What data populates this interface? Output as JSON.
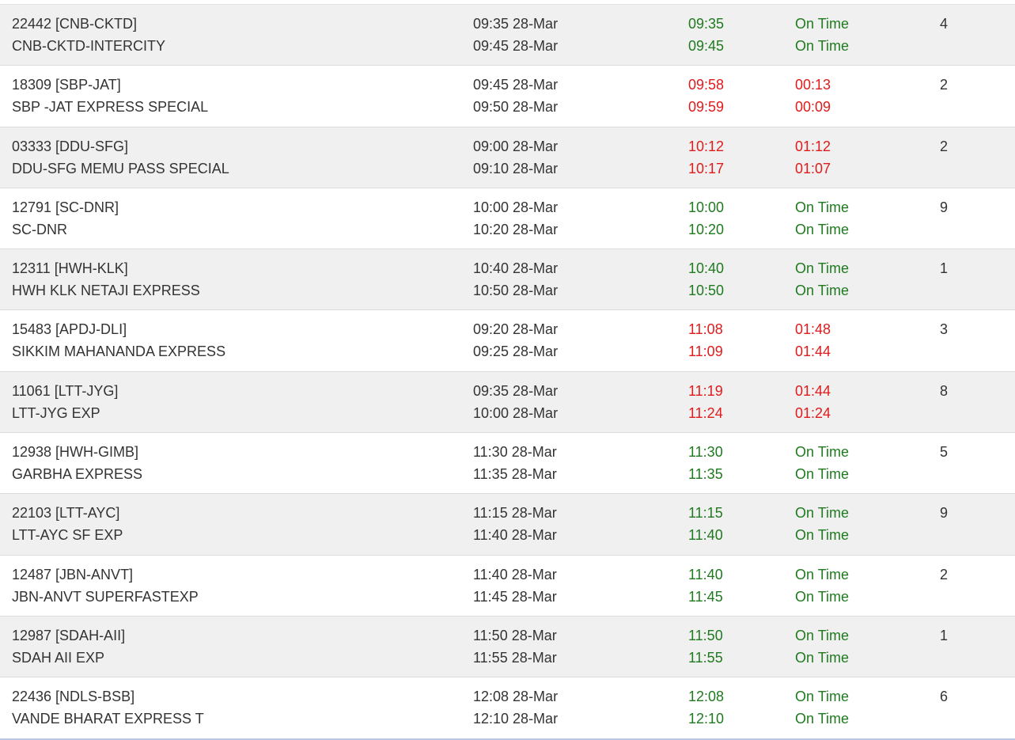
{
  "colors": {
    "on_time": "#1f7a1f",
    "delayed": "#e01b1b",
    "text": "#333333",
    "alt_row": "#f0f0f0"
  },
  "trains": [
    {
      "number": "22442 [CNB-CKTD]",
      "name": "CNB-CKTD-INTERCITY",
      "sch_arr": "09:35 28-Mar",
      "sch_dep": "09:45 28-Mar",
      "exp_arr": "09:35",
      "exp_dep": "09:45",
      "delay_arr": "On Time",
      "delay_dep": "On Time",
      "platform": "4",
      "late": false
    },
    {
      "number": "18309 [SBP-JAT]",
      "name": "SBP -JAT EXPRESS SPECIAL",
      "sch_arr": "09:45 28-Mar",
      "sch_dep": "09:50 28-Mar",
      "exp_arr": "09:58",
      "exp_dep": "09:59",
      "delay_arr": "00:13",
      "delay_dep": "00:09",
      "platform": "2",
      "late": true
    },
    {
      "number": "03333 [DDU-SFG]",
      "name": "DDU-SFG MEMU PASS SPECIAL",
      "sch_arr": "09:00 28-Mar",
      "sch_dep": "09:10 28-Mar",
      "exp_arr": "10:12",
      "exp_dep": "10:17",
      "delay_arr": "01:12",
      "delay_dep": "01:07",
      "platform": "2",
      "late": true
    },
    {
      "number": "12791 [SC-DNR]",
      "name": "SC-DNR",
      "sch_arr": "10:00 28-Mar",
      "sch_dep": "10:20 28-Mar",
      "exp_arr": "10:00",
      "exp_dep": "10:20",
      "delay_arr": "On Time",
      "delay_dep": "On Time",
      "platform": "9",
      "late": false
    },
    {
      "number": "12311 [HWH-KLK]",
      "name": "HWH KLK NETAJI EXPRESS",
      "sch_arr": "10:40 28-Mar",
      "sch_dep": "10:50 28-Mar",
      "exp_arr": "10:40",
      "exp_dep": "10:50",
      "delay_arr": "On Time",
      "delay_dep": "On Time",
      "platform": "1",
      "late": false
    },
    {
      "number": "15483 [APDJ-DLI]",
      "name": "SIKKIM MAHANANDA EXPRESS",
      "sch_arr": "09:20 28-Mar",
      "sch_dep": "09:25 28-Mar",
      "exp_arr": "11:08",
      "exp_dep": "11:09",
      "delay_arr": "01:48",
      "delay_dep": "01:44",
      "platform": "3",
      "late": true
    },
    {
      "number": "11061 [LTT-JYG]",
      "name": "LTT-JYG EXP",
      "sch_arr": "09:35 28-Mar",
      "sch_dep": "10:00 28-Mar",
      "exp_arr": "11:19",
      "exp_dep": "11:24",
      "delay_arr": "01:44",
      "delay_dep": "01:24",
      "platform": "8",
      "late": true
    },
    {
      "number": "12938 [HWH-GIMB]",
      "name": "GARBHA EXPRESS",
      "sch_arr": "11:30 28-Mar",
      "sch_dep": "11:35 28-Mar",
      "exp_arr": "11:30",
      "exp_dep": "11:35",
      "delay_arr": "On Time",
      "delay_dep": "On Time",
      "platform": "5",
      "late": false
    },
    {
      "number": "22103 [LTT-AYC]",
      "name": "LTT-AYC SF EXP",
      "sch_arr": "11:15 28-Mar",
      "sch_dep": "11:40 28-Mar",
      "exp_arr": "11:15",
      "exp_dep": "11:40",
      "delay_arr": "On Time",
      "delay_dep": "On Time",
      "platform": "9",
      "late": false
    },
    {
      "number": "12487 [JBN-ANVT]",
      "name": "JBN-ANVT SUPERFASTEXP",
      "sch_arr": "11:40 28-Mar",
      "sch_dep": "11:45 28-Mar",
      "exp_arr": "11:40",
      "exp_dep": "11:45",
      "delay_arr": "On Time",
      "delay_dep": "On Time",
      "platform": "2",
      "late": false
    },
    {
      "number": "12987 [SDAH-AII]",
      "name": "SDAH AII EXP",
      "sch_arr": "11:50 28-Mar",
      "sch_dep": "11:55 28-Mar",
      "exp_arr": "11:50",
      "exp_dep": "11:55",
      "delay_arr": "On Time",
      "delay_dep": "On Time",
      "platform": "1",
      "late": false
    },
    {
      "number": "22436 [NDLS-BSB]",
      "name": "VANDE BHARAT EXPRESS T",
      "sch_arr": "12:08 28-Mar",
      "sch_dep": "12:10 28-Mar",
      "exp_arr": "12:08",
      "exp_dep": "12:10",
      "delay_arr": "On Time",
      "delay_dep": "On Time",
      "platform": "6",
      "late": false
    }
  ]
}
